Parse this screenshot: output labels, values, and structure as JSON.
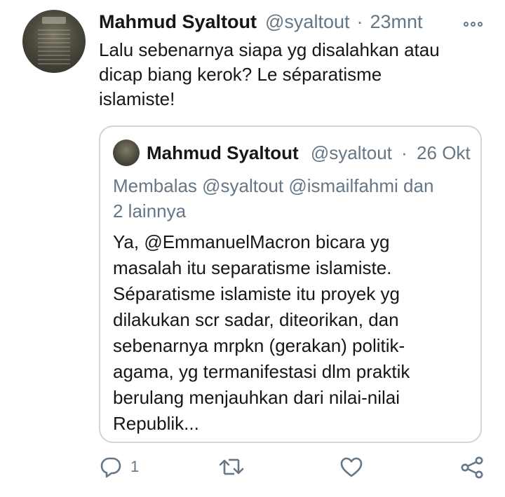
{
  "tweet": {
    "author_name": "Mahmud Syaltout",
    "handle": "@syaltout",
    "separator": "·",
    "time": "23mnt",
    "text_lines": [
      "Lalu sebenarnya siapa yg disalahkan atau",
      "dicap biang kerok? Le séparatisme",
      "islamiste!"
    ]
  },
  "quoted": {
    "author_name": "Mahmud Syaltout",
    "handle": "@syaltout",
    "separator": "·",
    "time": "26 Okt",
    "reply_lines": [
      "Membalas @syaltout @ismailfahmi  dan",
      "2 lainnya"
    ],
    "text_lines": [
      "Ya, @EmmanuelMacron bicara yg",
      "masalah itu separatisme islamiste.",
      "Séparatisme islamiste itu proyek yg",
      "dilakukan scr sadar, diteorikan, dan",
      "sebenarnya mrpkn (gerakan) politik-",
      "agama, yg termanifestasi dlm praktik",
      "berulang menjauhkan dari nilai-nilai",
      "Republik..."
    ]
  },
  "actions": {
    "reply_count": "1",
    "icons": [
      "reply-icon",
      "retweet-icon",
      "like-icon",
      "share-icon"
    ]
  },
  "colors": {
    "text": "#14171a",
    "secondary": "#657786",
    "border": "#ccd6dd"
  }
}
